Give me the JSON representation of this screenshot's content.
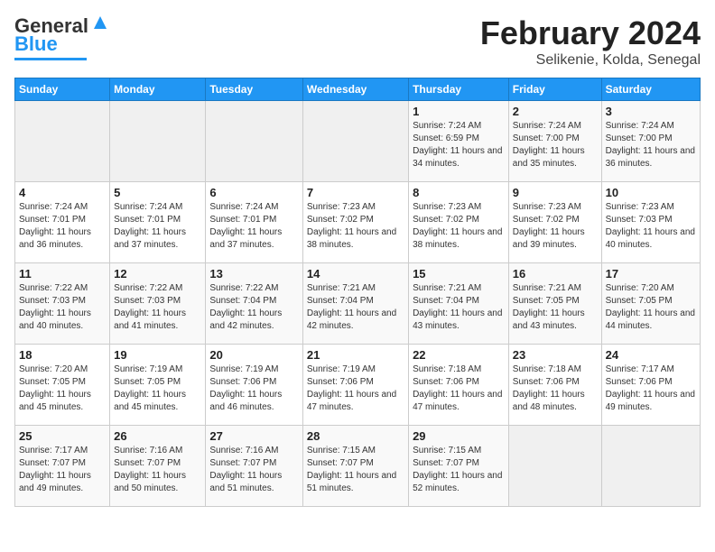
{
  "header": {
    "logo_general": "General",
    "logo_blue": "Blue",
    "title": "February 2024",
    "subtitle": "Selikenie, Kolda, Senegal"
  },
  "calendar": {
    "days_of_week": [
      "Sunday",
      "Monday",
      "Tuesday",
      "Wednesday",
      "Thursday",
      "Friday",
      "Saturday"
    ],
    "weeks": [
      [
        {
          "day": "",
          "sunrise": "",
          "sunset": "",
          "daylight": ""
        },
        {
          "day": "",
          "sunrise": "",
          "sunset": "",
          "daylight": ""
        },
        {
          "day": "",
          "sunrise": "",
          "sunset": "",
          "daylight": ""
        },
        {
          "day": "",
          "sunrise": "",
          "sunset": "",
          "daylight": ""
        },
        {
          "day": "1",
          "sunrise": "Sunrise: 7:24 AM",
          "sunset": "Sunset: 6:59 PM",
          "daylight": "Daylight: 11 hours and 34 minutes."
        },
        {
          "day": "2",
          "sunrise": "Sunrise: 7:24 AM",
          "sunset": "Sunset: 7:00 PM",
          "daylight": "Daylight: 11 hours and 35 minutes."
        },
        {
          "day": "3",
          "sunrise": "Sunrise: 7:24 AM",
          "sunset": "Sunset: 7:00 PM",
          "daylight": "Daylight: 11 hours and 36 minutes."
        }
      ],
      [
        {
          "day": "4",
          "sunrise": "Sunrise: 7:24 AM",
          "sunset": "Sunset: 7:01 PM",
          "daylight": "Daylight: 11 hours and 36 minutes."
        },
        {
          "day": "5",
          "sunrise": "Sunrise: 7:24 AM",
          "sunset": "Sunset: 7:01 PM",
          "daylight": "Daylight: 11 hours and 37 minutes."
        },
        {
          "day": "6",
          "sunrise": "Sunrise: 7:24 AM",
          "sunset": "Sunset: 7:01 PM",
          "daylight": "Daylight: 11 hours and 37 minutes."
        },
        {
          "day": "7",
          "sunrise": "Sunrise: 7:23 AM",
          "sunset": "Sunset: 7:02 PM",
          "daylight": "Daylight: 11 hours and 38 minutes."
        },
        {
          "day": "8",
          "sunrise": "Sunrise: 7:23 AM",
          "sunset": "Sunset: 7:02 PM",
          "daylight": "Daylight: 11 hours and 38 minutes."
        },
        {
          "day": "9",
          "sunrise": "Sunrise: 7:23 AM",
          "sunset": "Sunset: 7:02 PM",
          "daylight": "Daylight: 11 hours and 39 minutes."
        },
        {
          "day": "10",
          "sunrise": "Sunrise: 7:23 AM",
          "sunset": "Sunset: 7:03 PM",
          "daylight": "Daylight: 11 hours and 40 minutes."
        }
      ],
      [
        {
          "day": "11",
          "sunrise": "Sunrise: 7:22 AM",
          "sunset": "Sunset: 7:03 PM",
          "daylight": "Daylight: 11 hours and 40 minutes."
        },
        {
          "day": "12",
          "sunrise": "Sunrise: 7:22 AM",
          "sunset": "Sunset: 7:03 PM",
          "daylight": "Daylight: 11 hours and 41 minutes."
        },
        {
          "day": "13",
          "sunrise": "Sunrise: 7:22 AM",
          "sunset": "Sunset: 7:04 PM",
          "daylight": "Daylight: 11 hours and 42 minutes."
        },
        {
          "day": "14",
          "sunrise": "Sunrise: 7:21 AM",
          "sunset": "Sunset: 7:04 PM",
          "daylight": "Daylight: 11 hours and 42 minutes."
        },
        {
          "day": "15",
          "sunrise": "Sunrise: 7:21 AM",
          "sunset": "Sunset: 7:04 PM",
          "daylight": "Daylight: 11 hours and 43 minutes."
        },
        {
          "day": "16",
          "sunrise": "Sunrise: 7:21 AM",
          "sunset": "Sunset: 7:05 PM",
          "daylight": "Daylight: 11 hours and 43 minutes."
        },
        {
          "day": "17",
          "sunrise": "Sunrise: 7:20 AM",
          "sunset": "Sunset: 7:05 PM",
          "daylight": "Daylight: 11 hours and 44 minutes."
        }
      ],
      [
        {
          "day": "18",
          "sunrise": "Sunrise: 7:20 AM",
          "sunset": "Sunset: 7:05 PM",
          "daylight": "Daylight: 11 hours and 45 minutes."
        },
        {
          "day": "19",
          "sunrise": "Sunrise: 7:19 AM",
          "sunset": "Sunset: 7:05 PM",
          "daylight": "Daylight: 11 hours and 45 minutes."
        },
        {
          "day": "20",
          "sunrise": "Sunrise: 7:19 AM",
          "sunset": "Sunset: 7:06 PM",
          "daylight": "Daylight: 11 hours and 46 minutes."
        },
        {
          "day": "21",
          "sunrise": "Sunrise: 7:19 AM",
          "sunset": "Sunset: 7:06 PM",
          "daylight": "Daylight: 11 hours and 47 minutes."
        },
        {
          "day": "22",
          "sunrise": "Sunrise: 7:18 AM",
          "sunset": "Sunset: 7:06 PM",
          "daylight": "Daylight: 11 hours and 47 minutes."
        },
        {
          "day": "23",
          "sunrise": "Sunrise: 7:18 AM",
          "sunset": "Sunset: 7:06 PM",
          "daylight": "Daylight: 11 hours and 48 minutes."
        },
        {
          "day": "24",
          "sunrise": "Sunrise: 7:17 AM",
          "sunset": "Sunset: 7:06 PM",
          "daylight": "Daylight: 11 hours and 49 minutes."
        }
      ],
      [
        {
          "day": "25",
          "sunrise": "Sunrise: 7:17 AM",
          "sunset": "Sunset: 7:07 PM",
          "daylight": "Daylight: 11 hours and 49 minutes."
        },
        {
          "day": "26",
          "sunrise": "Sunrise: 7:16 AM",
          "sunset": "Sunset: 7:07 PM",
          "daylight": "Daylight: 11 hours and 50 minutes."
        },
        {
          "day": "27",
          "sunrise": "Sunrise: 7:16 AM",
          "sunset": "Sunset: 7:07 PM",
          "daylight": "Daylight: 11 hours and 51 minutes."
        },
        {
          "day": "28",
          "sunrise": "Sunrise: 7:15 AM",
          "sunset": "Sunset: 7:07 PM",
          "daylight": "Daylight: 11 hours and 51 minutes."
        },
        {
          "day": "29",
          "sunrise": "Sunrise: 7:15 AM",
          "sunset": "Sunset: 7:07 PM",
          "daylight": "Daylight: 11 hours and 52 minutes."
        },
        {
          "day": "",
          "sunrise": "",
          "sunset": "",
          "daylight": ""
        },
        {
          "day": "",
          "sunrise": "",
          "sunset": "",
          "daylight": ""
        }
      ]
    ]
  }
}
